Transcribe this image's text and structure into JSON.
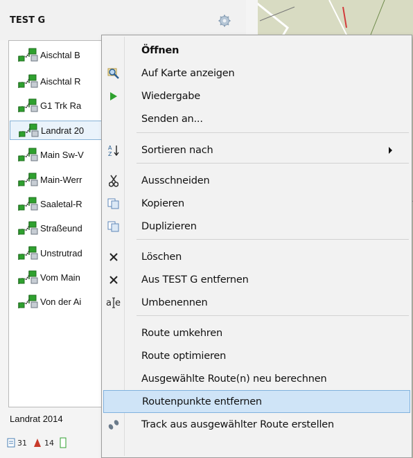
{
  "panel": {
    "title": "TEST G",
    "routes": [
      {
        "label": "Aischtal B"
      },
      {
        "label": "Aischtal R"
      },
      {
        "label": "G1 Trk Ra"
      },
      {
        "label": "Landrat 20"
      },
      {
        "label": "Main Sw-V"
      },
      {
        "label": "Main-Werr"
      },
      {
        "label": "Saaletal-R"
      },
      {
        "label": "Straßeund"
      },
      {
        "label": "Unstrutrad"
      },
      {
        "label": "Vom Main"
      },
      {
        "label": "Von der Ai"
      }
    ],
    "selected_name": "Landrat 2014",
    "counts": {
      "waypoints": "31",
      "pois": "14"
    }
  },
  "menu": {
    "items": [
      {
        "label": "Öffnen",
        "icon": "none",
        "bold": true
      },
      {
        "label": "Auf Karte anzeigen",
        "icon": "magnifier-map-icon"
      },
      {
        "label": "Wiedergabe",
        "icon": "play-icon"
      },
      {
        "label": "Senden an...",
        "icon": "none"
      },
      {
        "label": "Sortieren nach",
        "icon": "sort-az-icon",
        "submenu": true
      },
      {
        "label": "Ausschneiden",
        "icon": "scissors-icon"
      },
      {
        "label": "Kopieren",
        "icon": "copy-icon"
      },
      {
        "label": "Duplizieren",
        "icon": "duplicate-icon"
      },
      {
        "label": "Löschen",
        "icon": "delete-x-icon"
      },
      {
        "label": "Aus TEST G entfernen",
        "icon": "remove-x-icon"
      },
      {
        "label": "Umbenennen",
        "icon": "rename-icon"
      },
      {
        "label": "Route umkehren",
        "icon": "none"
      },
      {
        "label": "Route optimieren",
        "icon": "none"
      },
      {
        "label": "Ausgewählte Route(n) neu berechnen",
        "icon": "none"
      },
      {
        "label": "Routenpunkte entfernen",
        "icon": "none",
        "highlighted": true
      },
      {
        "label": "Track aus ausgewählter Route erstellen",
        "icon": "track-icon"
      }
    ]
  },
  "colors": {
    "highlight": "#cfe4f7",
    "highlight_border": "#7fb1de",
    "play_green": "#2ea12e",
    "route_green": "#2fa12f"
  }
}
